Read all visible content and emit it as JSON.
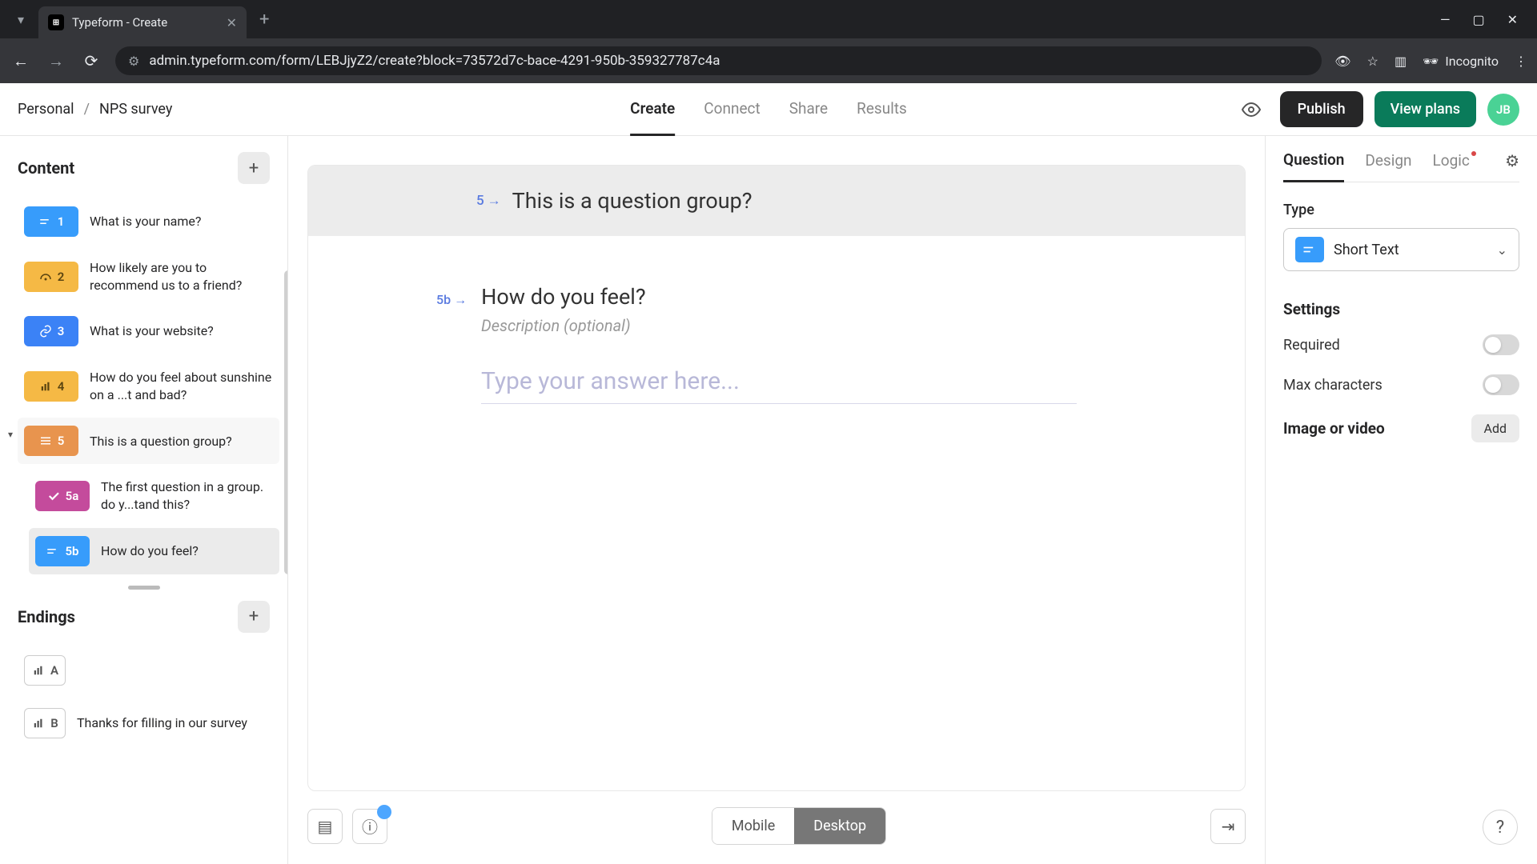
{
  "browser": {
    "tab_title": "Typeform - Create",
    "url": "admin.typeform.com/form/LEBJjyZ2/create?block=73572d7c-bace-4291-950b-359327787c4a",
    "incognito_label": "Incognito"
  },
  "header": {
    "workspace": "Personal",
    "form_name": "NPS survey",
    "tabs": {
      "create": "Create",
      "connect": "Connect",
      "share": "Share",
      "results": "Results"
    },
    "publish": "Publish",
    "view_plans": "View plans",
    "avatar": "JB"
  },
  "sidebar": {
    "content_title": "Content",
    "endings_title": "Endings",
    "items": [
      {
        "num": "1",
        "label": "What is your name?",
        "color": "blue"
      },
      {
        "num": "2",
        "label": "How likely are you to recommend us to a friend?",
        "color": "yellow"
      },
      {
        "num": "3",
        "label": "What is your website?",
        "color": "darkblue"
      },
      {
        "num": "4",
        "label": "How do you feel about sunshine on a ...t and bad?",
        "color": "yellow"
      },
      {
        "num": "5",
        "label": "This is a question group?",
        "color": "orange"
      },
      {
        "num": "5a",
        "label": "The first question in a group. do y...tand this?",
        "color": "magenta"
      },
      {
        "num": "5b",
        "label": "How do you feel?",
        "color": "blue"
      }
    ],
    "endings": [
      {
        "letter": "A",
        "label": ""
      },
      {
        "letter": "B",
        "label": "Thanks for filling in our survey"
      }
    ]
  },
  "canvas": {
    "group_num": "5",
    "group_title": "This is a question group?",
    "sub_num": "5b",
    "sub_title": "How do you feel?",
    "desc_placeholder": "Description (optional)",
    "answer_placeholder": "Type your answer here...",
    "view": {
      "mobile": "Mobile",
      "desktop": "Desktop"
    }
  },
  "panel": {
    "tabs": {
      "question": "Question",
      "design": "Design",
      "logic": "Logic"
    },
    "type_label": "Type",
    "type_value": "Short Text",
    "settings_heading": "Settings",
    "required_label": "Required",
    "maxchars_label": "Max characters",
    "media_heading": "Image or video",
    "add_label": "Add"
  }
}
